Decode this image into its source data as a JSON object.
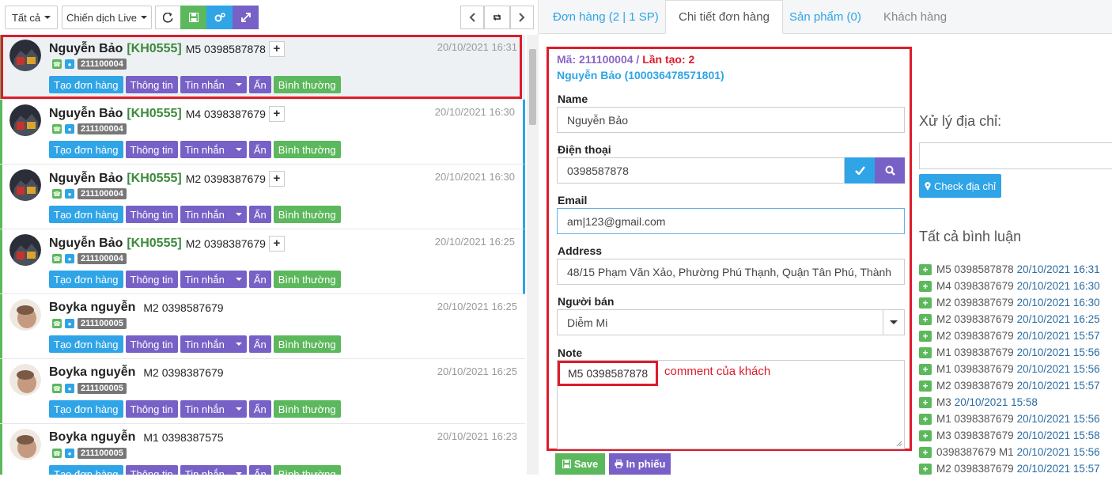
{
  "toolbar": {
    "filter_all": "Tất cả",
    "campaign": "Chiến dịch Live"
  },
  "rows": [
    {
      "name": "Nguyễn Bảo",
      "code": "[KH0555]",
      "comment": "M5 0398587878",
      "time": "20/10/2021 16:31",
      "order": "211100004",
      "type": "bao"
    },
    {
      "name": "Nguyễn Bảo",
      "code": "[KH0555]",
      "comment": "M4 0398387679",
      "time": "20/10/2021 16:30",
      "order": "211100004",
      "type": "bao"
    },
    {
      "name": "Nguyễn Bảo",
      "code": "[KH0555]",
      "comment": "M2 0398387679",
      "time": "20/10/2021 16:30",
      "order": "211100004",
      "type": "bao"
    },
    {
      "name": "Nguyễn Bảo",
      "code": "[KH0555]",
      "comment": "M2 0398387679",
      "time": "20/10/2021 16:25",
      "order": "211100004",
      "type": "bao"
    },
    {
      "name": "Boyka nguyễn",
      "code": "",
      "comment": "M2 0398587679",
      "time": "20/10/2021 16:25",
      "order": "211100005",
      "type": "boyka"
    },
    {
      "name": "Boyka nguyễn",
      "code": "",
      "comment": "M2 0398387679",
      "time": "20/10/2021 16:25",
      "order": "211100005",
      "type": "boyka"
    },
    {
      "name": "Boyka nguyễn",
      "code": "",
      "comment": "M1 0398387575",
      "time": "20/10/2021 16:23",
      "order": "211100005",
      "type": "boyka"
    }
  ],
  "row_actions": {
    "create_order": "Tạo đơn hàng",
    "info": "Thông tin",
    "message": "Tin nhắn",
    "hide": "Ẩn",
    "status": "Bình thường"
  },
  "tabs": {
    "orders": "Đơn hàng (2 | 1 SP)",
    "order_detail": "Chi tiết đơn hàng",
    "products": "Sản phẩm (0)",
    "customers": "Khách hàng"
  },
  "form": {
    "code_line_a": "Mã: 211100004 / ",
    "code_line_b": "Lần tạo: 2",
    "customer_line": "Nguyễn Bảo (100036478571801)",
    "name_label": "Name",
    "name_value": "Nguyễn Bảo",
    "phone_label": "Điện thoại",
    "phone_value": "0398587878",
    "email_label": "Email",
    "email_value": "am|123@gmail.com",
    "address_label": "Address",
    "address_value": "48/15 Phạm Văn Xảo, Phường Phú Thạnh, Quận Tân Phú, Thành",
    "seller_label": "Người bán",
    "seller_value": "Diễm Mi",
    "note_label": "Note",
    "note_value": "M5 0398587878",
    "note_annotation": "comment của khách",
    "save": "Save",
    "print": "In phiếu"
  },
  "address_tool": {
    "title": "Xử lý địa chỉ:",
    "check_button": "Check địa chỉ"
  },
  "comments": {
    "title": "Tất cả bình luận",
    "items": [
      {
        "text": "M5 0398587878",
        "date": "20/10/2021 16:31"
      },
      {
        "text": "M4 0398387679",
        "date": "20/10/2021 16:30"
      },
      {
        "text": "M2 0398387679",
        "date": "20/10/2021 16:30"
      },
      {
        "text": "M2 0398387679",
        "date": "20/10/2021 16:25"
      },
      {
        "text": "M2 0398387679",
        "date": "20/10/2021 15:57"
      },
      {
        "text": "M1 0398387679",
        "date": "20/10/2021 15:56"
      },
      {
        "text": "M1 0398387679",
        "date": "20/10/2021 15:56"
      },
      {
        "text": "M2 0398387679",
        "date": "20/10/2021 15:57"
      },
      {
        "text": "M3",
        "date": "20/10/2021 15:58"
      },
      {
        "text": "M1 0398387679",
        "date": "20/10/2021 15:56"
      },
      {
        "text": "M3 0398387679",
        "date": "20/10/2021 15:58"
      },
      {
        "text": "0398387679 M1",
        "date": "20/10/2021 15:56"
      },
      {
        "text": "M2 0398387679",
        "date": "20/10/2021 15:57"
      }
    ]
  },
  "colors": {
    "blue": "#2fa4e7",
    "purple": "#7761c7",
    "green": "#5cb85c",
    "red": "#dc1c2b"
  }
}
